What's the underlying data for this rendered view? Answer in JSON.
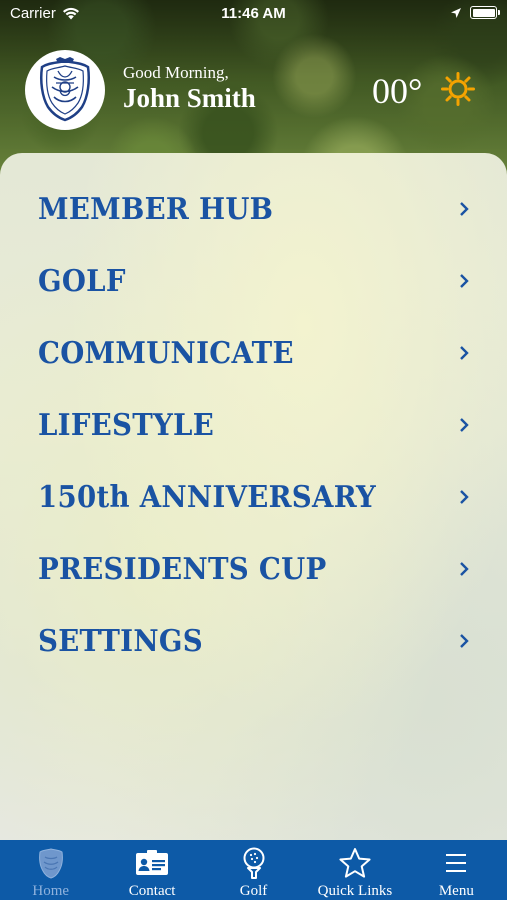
{
  "status_bar": {
    "carrier": "Carrier",
    "time": "11:46 AM"
  },
  "header": {
    "greeting": "Good Morning,",
    "user_name": "John Smith",
    "temperature": "00°",
    "weather_icon": "sun-icon",
    "logo": "club-crest"
  },
  "menu": {
    "items": [
      {
        "label": "MEMBER HUB"
      },
      {
        "label": "GOLF"
      },
      {
        "label": "COMMUNICATE"
      },
      {
        "label": "LIFESTYLE"
      },
      {
        "label": "150th ANNIVERSARY"
      },
      {
        "label": "PRESIDENTS CUP"
      },
      {
        "label": "SETTINGS"
      }
    ]
  },
  "tab_bar": {
    "tabs": [
      {
        "label": "Home",
        "icon": "crest-icon",
        "active": true
      },
      {
        "label": "Contact",
        "icon": "contact-card-icon"
      },
      {
        "label": "Golf",
        "icon": "golf-ball-icon"
      },
      {
        "label": "Quick Links",
        "icon": "star-icon"
      },
      {
        "label": "Menu",
        "icon": "hamburger-icon"
      }
    ]
  },
  "colors": {
    "accent": "#1a53a3",
    "tab_bar": "#0d5aa7",
    "sun": "#f5a300"
  }
}
